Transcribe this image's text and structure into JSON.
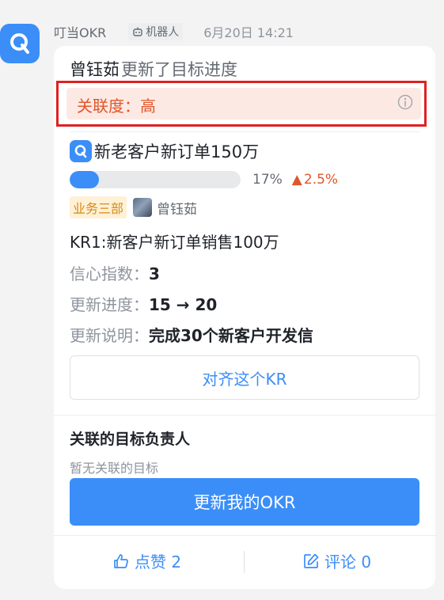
{
  "meta": {
    "sender": "叮当OKR",
    "bot_tag": "机器人",
    "timestamp": "6月20日 14:21"
  },
  "card": {
    "header_user": "曾钰茹",
    "header_action": "更新了目标进度",
    "relevance_label": "关联度：高",
    "objective": {
      "title": "新老客户新订单150万",
      "progress": 0.17,
      "progress_text": "17%",
      "delta_arrow": "▲",
      "delta_text": "2.5%",
      "department": "业务三部",
      "owner": "曾钰茹"
    },
    "kr": {
      "title": "KR1:新客户新订单销售100万",
      "confidence_label": "信心指数：",
      "confidence_value": "3",
      "progress_label": "更新进度：",
      "progress_value": "15 → 20",
      "note_label": "更新说明：",
      "note_value": "完成30个新客户开发信"
    },
    "align_button": "对齐这个KR",
    "related_section": {
      "title": "关联的目标负责人",
      "empty_text": "暂无关联的目标"
    },
    "update_button": "更新我的OKR",
    "footer": {
      "like_label": "点赞 2",
      "comment_label": "评论 0"
    }
  },
  "colors": {
    "accent": "#3b8ef8",
    "relevance_bg": "#fde9e4",
    "relevance_text": "#e0562b",
    "highlight_border": "#e02020",
    "dept_tag_bg": "#fff1d6",
    "dept_tag_text": "#d68a1a"
  },
  "icons": {
    "app_avatar": "dingdang-okr-logo-icon",
    "bot": "robot-icon",
    "info": "info-circle-icon",
    "objective": "objective-icon",
    "like": "thumbs-up-icon",
    "comment": "edit-comment-icon"
  }
}
